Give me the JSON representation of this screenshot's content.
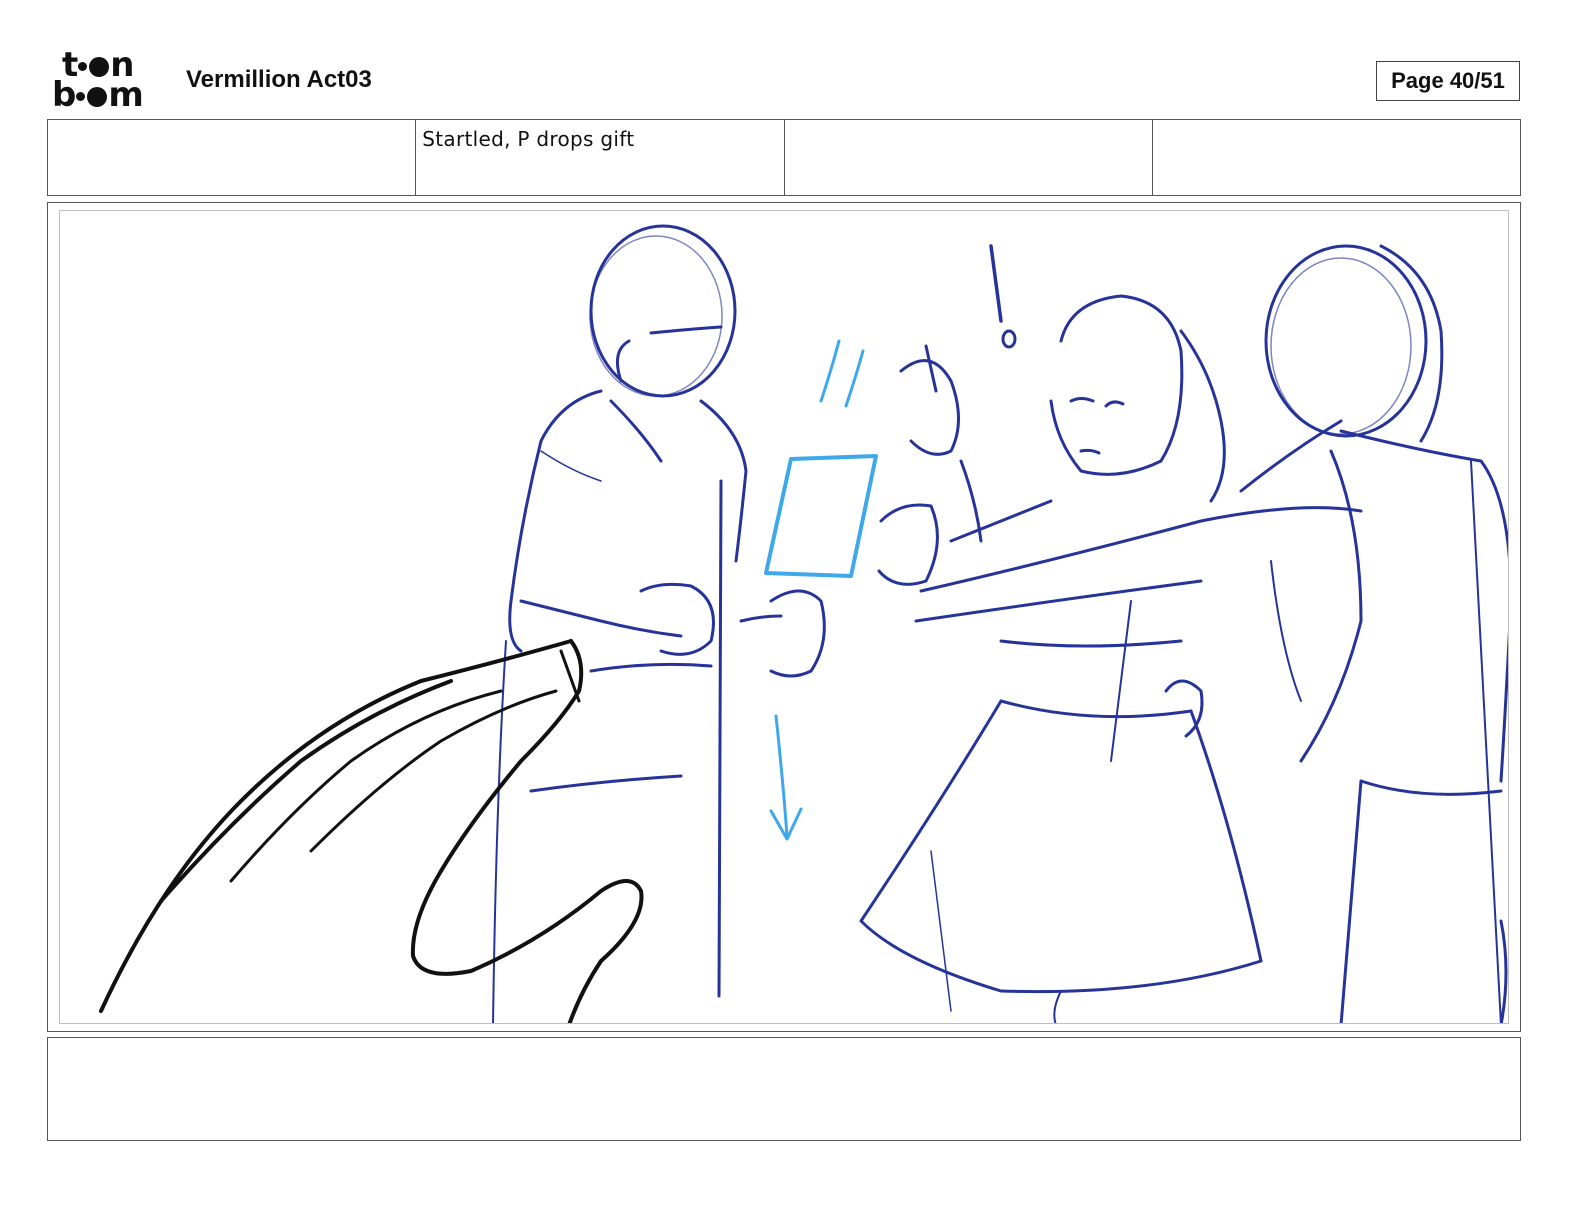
{
  "header": {
    "logo": {
      "line1": "toon",
      "line2": "boom",
      "icon": "toonboom-logo"
    },
    "project_title": "Vermillion Act03",
    "page_label": "Page 40/51"
  },
  "captions": [
    {
      "text": ""
    },
    {
      "text": "Startled, P drops gift"
    },
    {
      "text": ""
    },
    {
      "text": ""
    }
  ],
  "panel": {
    "colors": {
      "sketch_dark_blue": "#26349a",
      "sketch_light_blue": "#3ea8ea",
      "sketch_black": "#111111"
    }
  },
  "notes": {
    "text": ""
  }
}
